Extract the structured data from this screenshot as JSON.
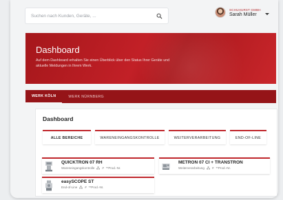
{
  "search": {
    "placeholder": "Suchen nach Kunden, Geräte, ..."
  },
  "user": {
    "company": "SCHUHURST GMBH",
    "name": "Sarah Müller"
  },
  "hero": {
    "title": "Dashboard",
    "description": "Auf dem Dashboard erhalten Sie einen Überblick über den Status Ihrer Geräte und aktuelle Meldungen in Ihrem Werk."
  },
  "tabs": [
    {
      "label": "WERK KÖLN"
    },
    {
      "label": "WERK NÜRNBERG"
    }
  ],
  "panel": {
    "title": "Dashboard"
  },
  "filters": [
    {
      "label": "ALLE BEREICHE"
    },
    {
      "label": "WARENEINGANGSKONTROLLE"
    },
    {
      "label": "WEITERVERARBEITUNG"
    },
    {
      "label": "END-OF-LINE"
    }
  ],
  "cards": [
    {
      "name": "QUICKTRON 07 RH",
      "area": "Wareneingangskontrolle",
      "prod": "**Prod.-Nr."
    },
    {
      "name": "METRON 07 CI + TRANSTRON",
      "area": "Weiterverarbeitung",
      "prod": "**Prod.-Nr."
    },
    {
      "name": "easySCOPE ST",
      "area": "End-of-Line",
      "prod": "**Prod.-Nr."
    }
  ],
  "colors": {
    "accent": "#c0262b",
    "tabbar": "#951418",
    "hero": "#b51c21"
  },
  "icons": [
    "search-icon",
    "chevron-down-icon",
    "device-icon",
    "team-icon",
    "hash-icon"
  ]
}
